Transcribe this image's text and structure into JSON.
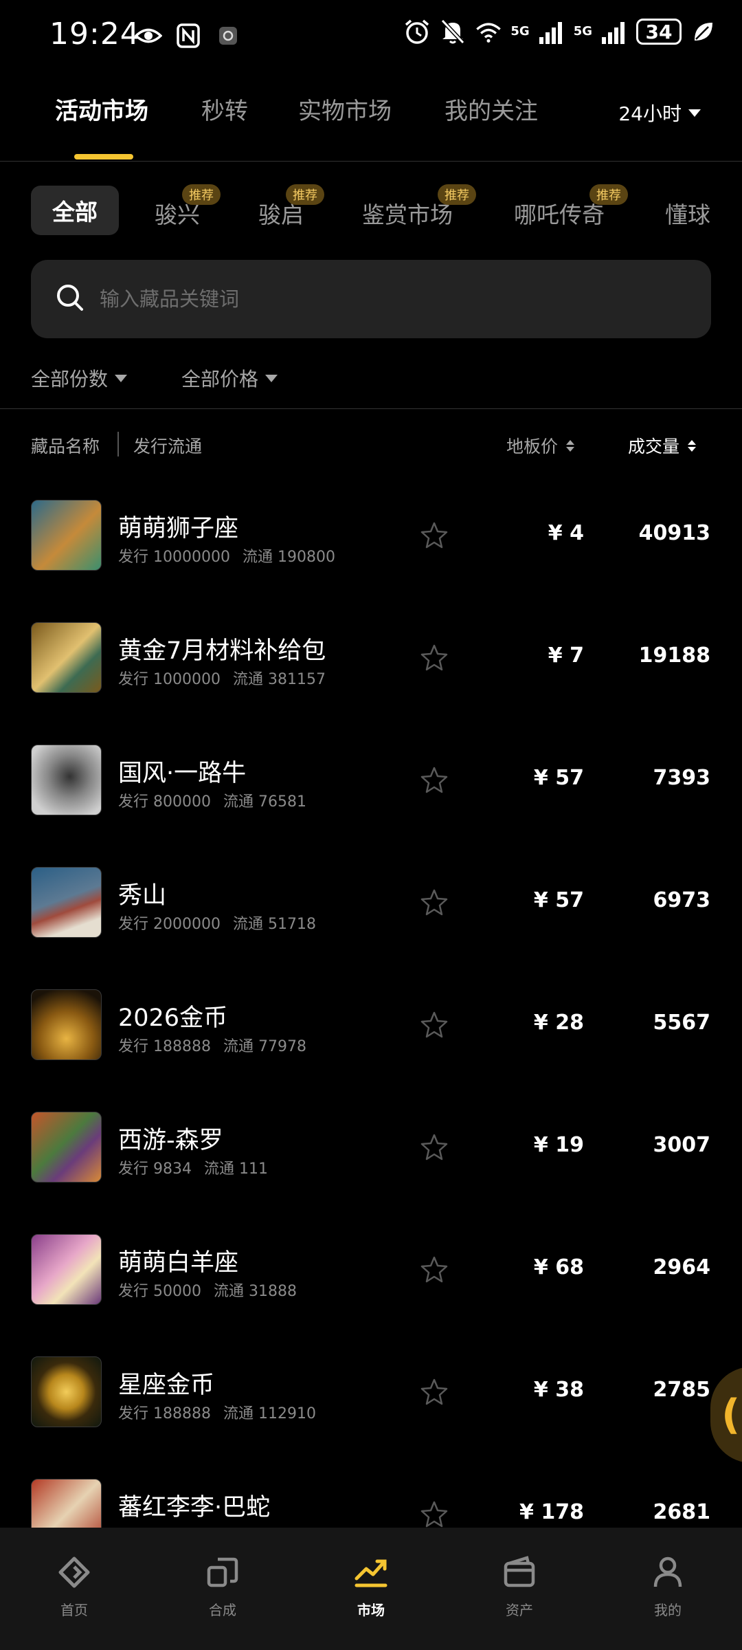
{
  "status_bar": {
    "time": "19:24",
    "net1": "5G",
    "net2": "5G",
    "battery": "34"
  },
  "top_tabs": [
    {
      "label": "活动市场",
      "active": true
    },
    {
      "label": "秒转",
      "active": false
    },
    {
      "label": "实物市场",
      "active": false
    },
    {
      "label": "我的关注",
      "active": false
    }
  ],
  "period_selector": "24小时",
  "categories": [
    {
      "label": "全部",
      "active": true,
      "badge": ""
    },
    {
      "label": "骏兴",
      "active": false,
      "badge": "推荐"
    },
    {
      "label": "骏启",
      "active": false,
      "badge": "推荐"
    },
    {
      "label": "鉴赏市场",
      "active": false,
      "badge": "推荐"
    },
    {
      "label": "哪吒传奇",
      "active": false,
      "badge": "推荐"
    },
    {
      "label": "懂球",
      "active": false,
      "badge": ""
    }
  ],
  "search": {
    "placeholder": "输入藏品关键词"
  },
  "filters": {
    "count": "全部份数",
    "price": "全部价格"
  },
  "columns": {
    "name": "藏品名称",
    "circulation": "发行流通",
    "floor_price": "地板价",
    "volume": "成交量"
  },
  "items": [
    {
      "name": "萌萌狮子座",
      "issue": "发行 10000000",
      "circulation": "流通 190800",
      "price": "¥ 4",
      "volume": "40913"
    },
    {
      "name": "黄金7月材料补给包",
      "issue": "发行 1000000",
      "circulation": "流通 381157",
      "price": "¥ 7",
      "volume": "19188"
    },
    {
      "name": "国风·一路牛",
      "issue": "发行 800000",
      "circulation": "流通 76581",
      "price": "¥ 57",
      "volume": "7393"
    },
    {
      "name": "秀山",
      "issue": "发行 2000000",
      "circulation": "流通 51718",
      "price": "¥ 57",
      "volume": "6973"
    },
    {
      "name": "2026金币",
      "issue": "发行 188888",
      "circulation": "流通 77978",
      "price": "¥ 28",
      "volume": "5567"
    },
    {
      "name": "西游-森罗",
      "issue": "发行 9834",
      "circulation": "流通 111",
      "price": "¥ 19",
      "volume": "3007"
    },
    {
      "name": "萌萌白羊座",
      "issue": "发行 50000",
      "circulation": "流通 31888",
      "price": "¥ 68",
      "volume": "2964"
    },
    {
      "name": "星座金币",
      "issue": "发行 188888",
      "circulation": "流通 112910",
      "price": "¥ 38",
      "volume": "2785"
    },
    {
      "name": "蕃红李李·巴蛇",
      "issue": "",
      "circulation": "",
      "price": "¥ 178",
      "volume": "2681"
    }
  ],
  "bottom_nav": [
    {
      "label": "首页",
      "icon": "home-icon",
      "active": false
    },
    {
      "label": "合成",
      "icon": "synthesize-icon",
      "active": false
    },
    {
      "label": "市场",
      "icon": "market-trend-icon",
      "active": true
    },
    {
      "label": "资产",
      "icon": "wallet-icon",
      "active": false
    },
    {
      "label": "我的",
      "icon": "profile-icon",
      "active": false
    }
  ],
  "colors": {
    "accent": "#f5c531",
    "badge_bg": "#5a4413",
    "badge_text": "#f3c961",
    "background": "#000000",
    "panel": "#232323"
  }
}
